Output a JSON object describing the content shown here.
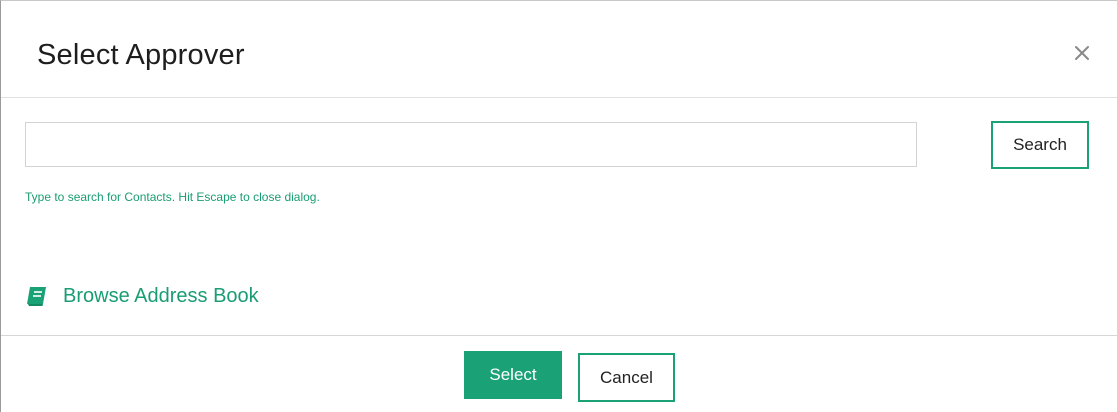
{
  "dialog": {
    "title": "Select Approver",
    "close_icon": "close-icon"
  },
  "search": {
    "value": "",
    "placeholder": "",
    "button_label": "Search",
    "hint": "Type to search for Contacts. Hit Escape to close dialog."
  },
  "browse": {
    "icon": "book-icon",
    "label": "Browse Address Book"
  },
  "footer": {
    "select_label": "Select",
    "cancel_label": "Cancel"
  },
  "colors": {
    "accent": "#1aa276",
    "hint_text": "#1a9d73",
    "title_text": "#1e1e1e"
  }
}
